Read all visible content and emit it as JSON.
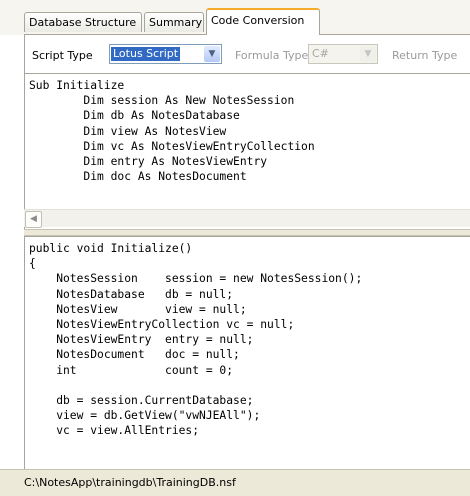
{
  "tabs": [
    {
      "label": "Database Structure",
      "active": false
    },
    {
      "label": "Summary",
      "active": false
    },
    {
      "label": "Code Conversion",
      "active": true
    }
  ],
  "toolbar": {
    "script_type_label": "Script Type",
    "script_type_value": "Lotus Script",
    "formula_type_label": "Formula Type",
    "formula_type_value": "C#",
    "return_type_label": "Return Type"
  },
  "lotus_script": "Sub Initialize\n        Dim session As New NotesSession\n        Dim db As NotesDatabase\n        Dim view As NotesView\n        Dim vc As NotesViewEntryCollection\n        Dim entry As NotesViewEntry\n        Dim doc As NotesDocument",
  "csharp_code": "public void Initialize()\n{\n    NotesSession    session = new NotesSession();\n    NotesDatabase   db = null;\n    NotesView       view = null;\n    NotesViewEntryCollection vc = null;\n    NotesViewEntry  entry = null;\n    NotesDocument   doc = null;\n    int             count = 0;\n\n    db = session.CurrentDatabase;\n    view = db.GetView(\"vwNJEAll\");\n    vc = view.AllEntries;",
  "status": {
    "path": "C:\\NotesApp\\trainingdb\\TrainingDB.nsf"
  },
  "icons": {
    "dropdown": "chevron-down-icon",
    "scroll_left": "arrow-left-icon"
  }
}
